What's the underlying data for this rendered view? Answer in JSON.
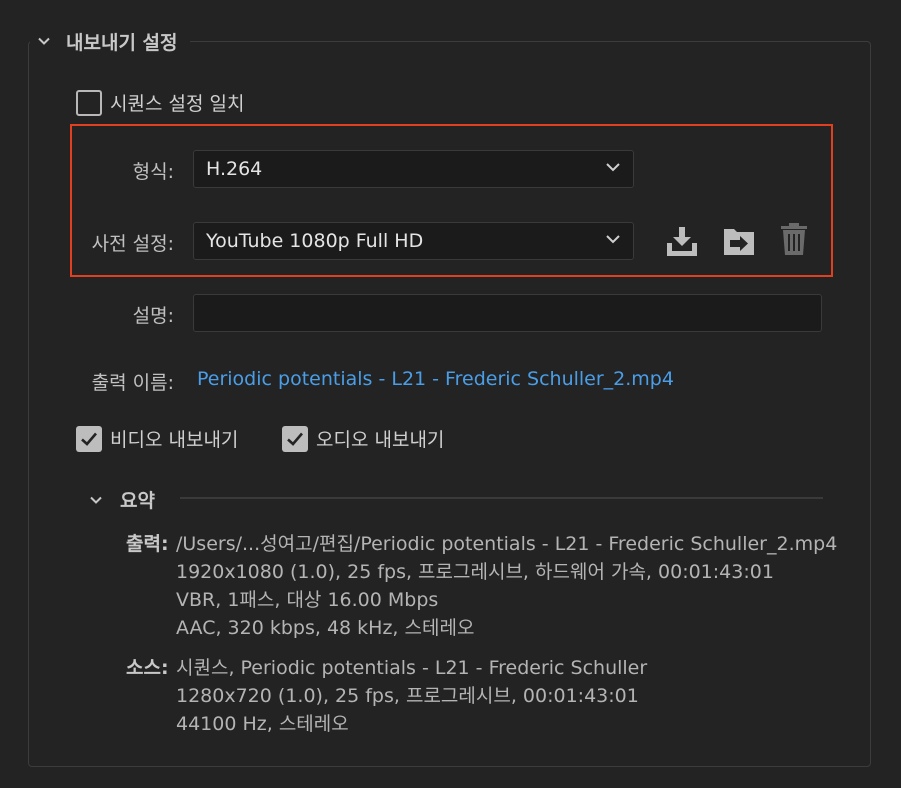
{
  "export_settings": {
    "title": "내보내기 설정",
    "match_sequence": {
      "label": "시퀀스 설정 일치",
      "checked": false
    },
    "format": {
      "label": "형식:",
      "value": "H.264"
    },
    "preset": {
      "label": "사전 설정:",
      "value": "YouTube 1080p Full HD"
    },
    "preset_actions": [
      "save-preset-icon",
      "import-preset-icon",
      "delete-preset-icon"
    ],
    "comments": {
      "label": "설명:",
      "value": ""
    },
    "output_name": {
      "label": "출력 이름:",
      "value": "Periodic potentials - L21 - Frederic Schuller_2.mp4"
    },
    "export_video": {
      "label": "비디오 내보내기",
      "checked": true
    },
    "export_audio": {
      "label": "오디오 내보내기",
      "checked": true
    }
  },
  "summary": {
    "title": "요약",
    "output": {
      "label": "출력:",
      "lines": [
        "/Users/...성여고/편집/Periodic potentials - L21 - Frederic Schuller_2.mp4",
        "1920x1080 (1.0), 25 fps, 프로그레시브, 하드웨어 가속, 00:01:43:01",
        "VBR, 1패스, 대상 16.00 Mbps",
        "AAC, 320 kbps, 48 kHz, 스테레오"
      ]
    },
    "source": {
      "label": "소스:",
      "lines": [
        "시퀀스, Periodic potentials - L21 - Frederic Schuller",
        "1280x720 (1.0), 25 fps, 프로그레시브, 00:01:43:01",
        "44100 Hz, 스테레오"
      ]
    }
  },
  "colors": {
    "background": "#232323",
    "highlight": "#e0401f",
    "link": "#4a9ee8"
  }
}
